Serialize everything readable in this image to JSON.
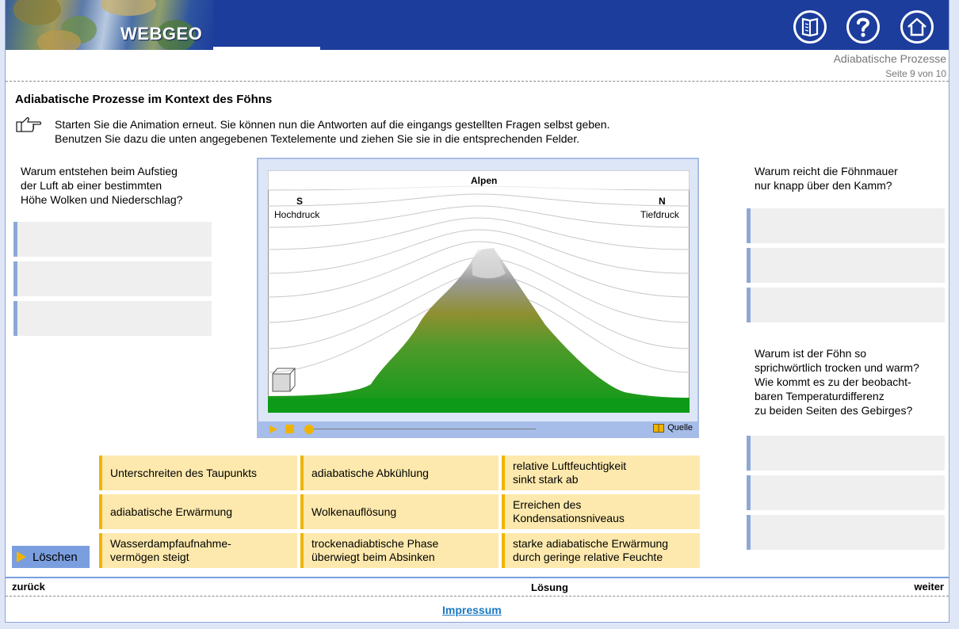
{
  "header": {
    "logo": "WEBGEO",
    "buttons": [
      {
        "name": "book-icon"
      },
      {
        "name": "help-icon"
      },
      {
        "name": "home-icon"
      }
    ],
    "module_title": "Adiabatische Prozesse",
    "page_info": "Seite 9 von 10"
  },
  "main": {
    "title": "Adiabatische Prozesse im Kontext des Föhns",
    "instruction_line1": "Starten Sie die Animation erneut. Sie können nun die Antworten auf die eingangs gestellten Fragen selbst geben.",
    "instruction_line2": "Benutzen Sie dazu die unten angegebenen Textelemente und ziehen Sie sie in die entsprechenden Felder."
  },
  "questions": {
    "left": "Warum entstehen beim Aufstieg\nder Luft ab einer bestimmten\nHöhe Wolken und Niederschlag?",
    "right_top": "Warum reicht die Föhnmauer\nnur knapp über den Kamm?",
    "right_bottom": "Warum ist der Föhn so\nsprichwörtlich trocken und warm?\nWie kommt es zu der beobacht-\nbaren Temperaturdifferenz\nzu beiden Seiten des Gebirges?"
  },
  "animation": {
    "title": "Alpen",
    "left_dir": "S",
    "left_label": "Hochdruck",
    "right_dir": "N",
    "right_label": "Tiefdruck",
    "quelle": "Quelle",
    "progress": 0
  },
  "chips": [
    "Unterschreiten des Taupunkts",
    "adiabatische Abkühlung",
    "relative Luftfeuchtigkeit\nsinkt stark ab",
    "adiabatische Erwärmung",
    "Wolkenauflösung",
    "Erreichen des\nKondensationsniveaus",
    "Wasserdampfaufnahme-\nvermögen steigt",
    "trockenadiabtische Phase\nüberwiegt beim Absinken",
    "starke adiabatische Erwärmung\ndurch geringe relative Feuchte"
  ],
  "footer": {
    "delete": "Löschen",
    "back": "zurück",
    "solution": "Lösung",
    "next": "weiter",
    "impressum": "Impressum"
  },
  "colors": {
    "header_blue": "#1d3d9c",
    "chip_bg": "#fde9ad",
    "chip_accent": "#f0b400",
    "slot_accent": "#8da8d6"
  }
}
